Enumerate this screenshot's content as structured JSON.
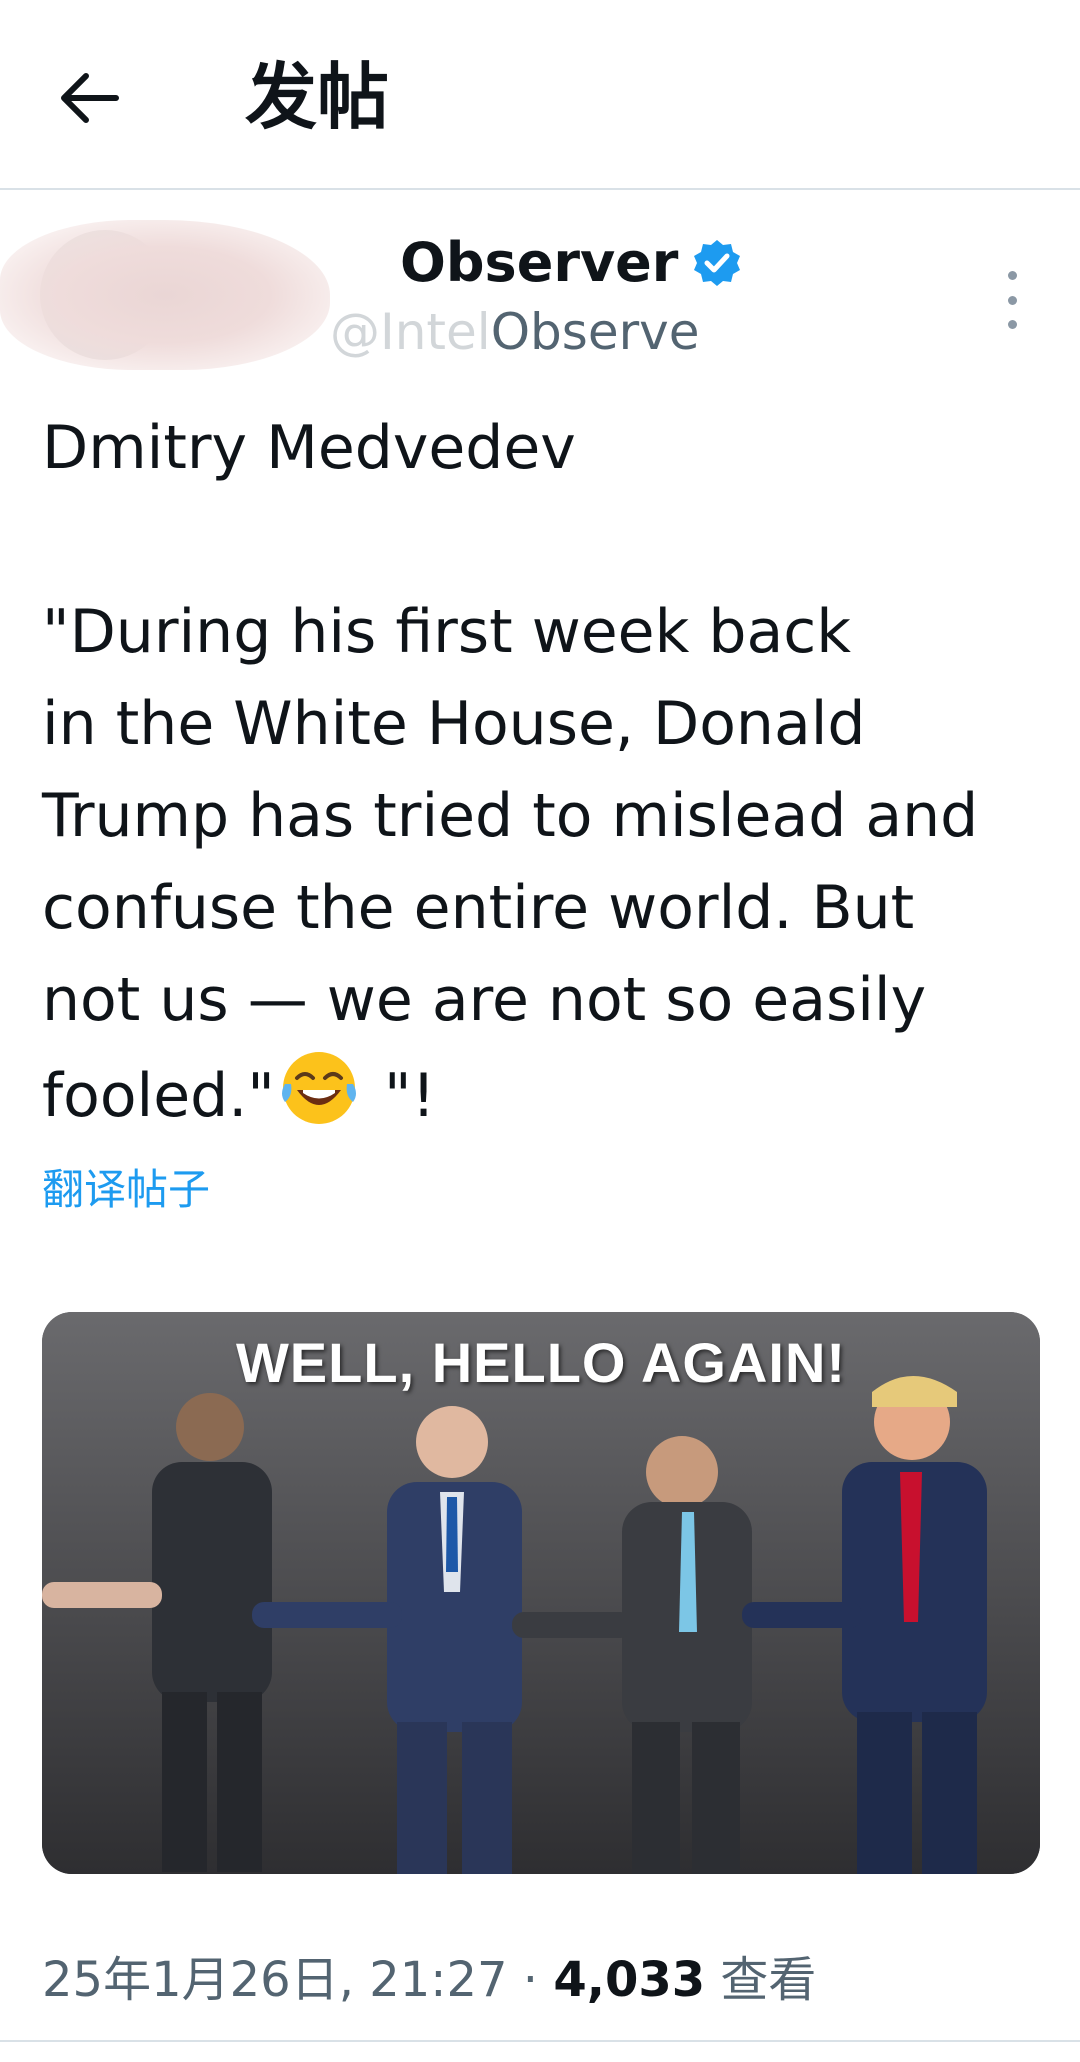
{
  "header": {
    "back_icon": "arrow-left-icon",
    "title": "发帖"
  },
  "author": {
    "display_name_hidden": "Intel",
    "display_name": "Observer",
    "verified_icon": "verified-badge-icon",
    "verified_color": "#1d9bf0",
    "handle_hidden": "@Intel",
    "handle": "Observe",
    "more_icon": "more-vertical-icon"
  },
  "post": {
    "line_1": "Dmitry Medvedev",
    "line_2": "",
    "line_3": "\"During his first week back",
    "line_4": "in the White House, Donald",
    "line_5": "Trump has tried to mislead and",
    "line_6": "confuse the entire world. But",
    "line_7": "not us — we are not so easily",
    "line_8a": "fooled.\"",
    "emoji_icon": "tears-of-joy-emoji-icon",
    "line_8b": " \"!",
    "translate_label": "翻译帖子",
    "translate_color": "#1d9bf0"
  },
  "media": {
    "caption": "WELL, HELLO AGAIN!"
  },
  "meta": {
    "timestamp": "25年1月26日, 21:27",
    "separator": " · ",
    "view_count": "4,033",
    "view_label": " 查看"
  }
}
